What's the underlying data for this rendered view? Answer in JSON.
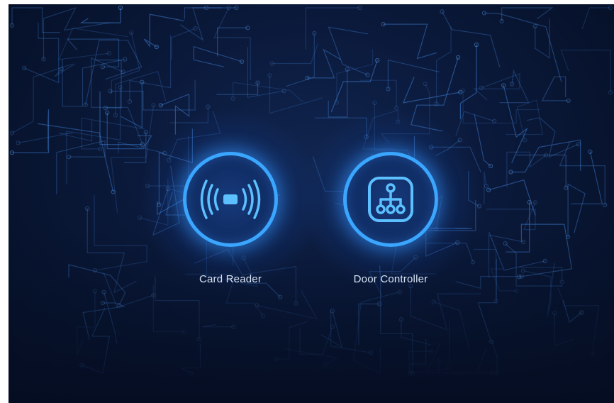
{
  "devices": [
    {
      "label": "Card Reader",
      "icon": "card-reader-rfid-icon"
    },
    {
      "label": "Door Controller",
      "icon": "network-hierarchy-icon"
    }
  ],
  "colors": {
    "accent": "#3aa6ff",
    "background": "#0b1a3c",
    "label": "#d7e3f5"
  }
}
